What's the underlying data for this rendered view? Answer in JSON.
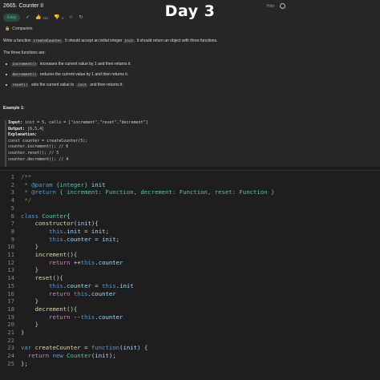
{
  "header": {
    "problem_title": "2665. Counter II",
    "overlay_title": "Day 3",
    "hint": "Hint",
    "difficulty": "Easy",
    "likes": "251",
    "dislikes": "4",
    "companies": "Companies"
  },
  "description": {
    "intro_a": "Write a function ",
    "intro_code_fn": "createCounter",
    "intro_b": ". It should accept an initial integer ",
    "intro_code_init": "init",
    "intro_c": ". It should return an object with three functions.",
    "three": "The three functions are:",
    "bullets": [
      {
        "code": "increment()",
        "text": " increases the current value by 1 and then returns it."
      },
      {
        "code": "decrement()",
        "text": " reduces the current value by 1 and then returns it."
      },
      {
        "code": "reset()",
        "text": " sets the current value to ",
        "code2": "init",
        "text2": " and then returns it."
      }
    ]
  },
  "example": {
    "title": "Example 1:",
    "input_label": "Input:",
    "input_value": " init = 5, calls = [\"increment\",\"reset\",\"decrement\"]",
    "output_label": "Output:",
    "output_value": " [6,5,4]",
    "explanation_label": "Explanation:",
    "lines": [
      "const counter = createCounter(5);",
      "counter.increment(); // 6",
      "counter.reset(); // 5",
      "counter.decrement(); // 4"
    ]
  },
  "editor": {
    "line_numbers": [
      "1",
      "2",
      "3",
      "4",
      "5",
      "6",
      "7",
      "8",
      "9",
      "10",
      "11",
      "12",
      "13",
      "14",
      "15",
      "16",
      "17",
      "18",
      "19",
      "20",
      "21",
      "22",
      "23",
      "24",
      "25"
    ],
    "icons": {
      "hint": "hint-icon",
      "like": "thumbs-up-icon",
      "dislike": "thumbs-down-icon",
      "star": "star-icon",
      "share": "share-icon",
      "check": "check-icon",
      "lock": "lock-icon",
      "timer": "timer-icon"
    }
  },
  "colors": {
    "easy_badge_text": "#3ec7a5",
    "easy_badge_bg": "#2b4a40",
    "editor_bg": "#1e1e1e",
    "desc_bg": "#262626"
  }
}
